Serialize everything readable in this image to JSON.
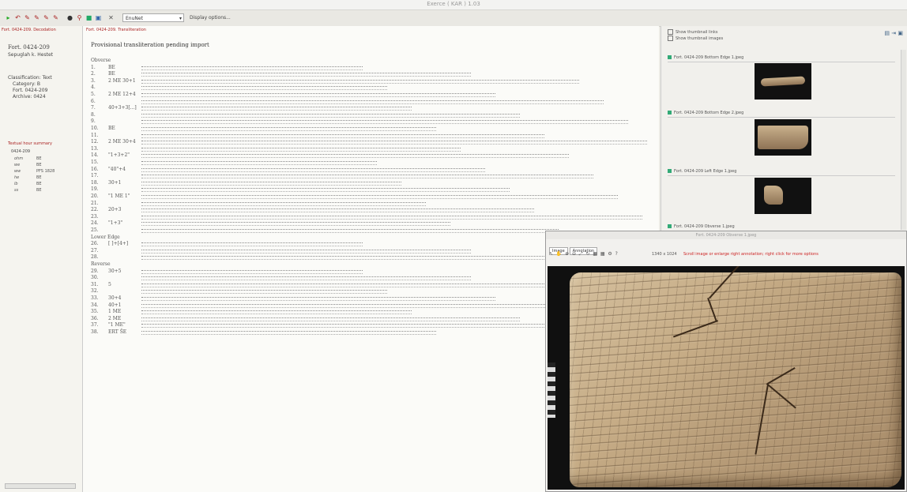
{
  "window": {
    "title": "Exerce ( KAR ) 1.03"
  },
  "toolbar": {
    "icons": [
      "run-icon",
      "back-icon",
      "edit-icon",
      "edit-icon",
      "edit-icon",
      "edit-icon",
      "delete-icon",
      "search-icon",
      "save-icon",
      "image-icon",
      "close-icon"
    ],
    "select_value": "EnuNet",
    "link": "Display options..."
  },
  "left_panel": {
    "tab": "Fort. 0424-209. Decodation",
    "id": "Fort. 0424-209",
    "subtitle": "Sepuglah k. Hestet",
    "classification": [
      "Classification: Text",
      "Category: B",
      "Fort. 0424-209",
      "Archive: 0424"
    ],
    "summary_title": "Textual hour summary",
    "summary_id": "0424-209",
    "rows": [
      {
        "a": "ohm",
        "b": "BE"
      },
      {
        "a": "we",
        "b": "BE"
      },
      {
        "a": "ww",
        "b": "PFS 1828"
      },
      {
        "a": "he",
        "b": "BE"
      },
      {
        "a": "lb",
        "b": "BE"
      },
      {
        "a": "ss",
        "b": "BE"
      }
    ]
  },
  "center": {
    "tab": "Fort. 0424-209. Transliteration",
    "title": "Provisional transliteration pending import",
    "sections": [
      "Obverse",
      "Lower Edge",
      "Reverse"
    ],
    "obverse_lines": [
      {
        "n": "1.",
        "l": "BE"
      },
      {
        "n": "2.",
        "l": "BE"
      },
      {
        "n": "3.",
        "l": "2 ME 30+1"
      },
      {
        "n": "4.",
        "l": ""
      },
      {
        "n": "5.",
        "l": "2 ME 12+4"
      },
      {
        "n": "6.",
        "l": ""
      },
      {
        "n": "7.",
        "l": "40+3+3[...]"
      },
      {
        "n": "8.",
        "l": ""
      },
      {
        "n": "9.",
        "l": ""
      },
      {
        "n": "10.",
        "l": "BE"
      },
      {
        "n": "11.",
        "l": ""
      },
      {
        "n": "12.",
        "l": "2 ME 30+4"
      },
      {
        "n": "13.",
        "l": ""
      },
      {
        "n": "14.",
        "l": "\"1+3+2\""
      },
      {
        "n": "15.",
        "l": ""
      },
      {
        "n": "16.",
        "l": "\"40\"+4"
      },
      {
        "n": "17.",
        "l": ""
      },
      {
        "n": "18.",
        "l": "30+1"
      },
      {
        "n": "19.",
        "l": ""
      },
      {
        "n": "20.",
        "l": "\"1 ME 1\""
      },
      {
        "n": "21.",
        "l": ""
      },
      {
        "n": "22.",
        "l": "20+3"
      },
      {
        "n": "23.",
        "l": ""
      },
      {
        "n": "24.",
        "l": "\"1+3\""
      },
      {
        "n": "25.",
        "l": ""
      }
    ],
    "lower_edge_lines": [
      {
        "n": "26.",
        "l": "[ ]+[4+]"
      },
      {
        "n": "27.",
        "l": ""
      },
      {
        "n": "28.",
        "l": ""
      }
    ],
    "reverse_lines": [
      {
        "n": "29.",
        "l": "30+5"
      },
      {
        "n": "30.",
        "l": ""
      },
      {
        "n": "31.",
        "l": "5"
      },
      {
        "n": "32.",
        "l": ""
      },
      {
        "n": "33.",
        "l": "30+4"
      },
      {
        "n": "34.",
        "l": "40+1"
      },
      {
        "n": "35.",
        "l": "1 ME"
      },
      {
        "n": "36.",
        "l": "2 ME"
      },
      {
        "n": "37.",
        "l": "\"1 ME\""
      },
      {
        "n": "38.",
        "l": "ERT ŠE"
      }
    ]
  },
  "right_panel": {
    "checkbox1": "Show thumbnail links",
    "checkbox2": "Show thumbnail images",
    "thumbs": [
      "Fort. 0424-209 Bottom Edge 1.jpeg",
      "Fort. 0424-209 Bottom Edge 2.jpeg",
      "Fort. 0424-209 Left Edge 1.jpeg",
      "Fort. 0424-209 Obverse 1.jpeg"
    ]
  },
  "viewer": {
    "title": "Fort. 0424-209 Obverse 1.jpeg",
    "tabs": [
      "Image",
      "Annotation"
    ],
    "zoom": "1340 x 1024",
    "message": "Scroll image or enlarge right annotation; right click for more options"
  }
}
